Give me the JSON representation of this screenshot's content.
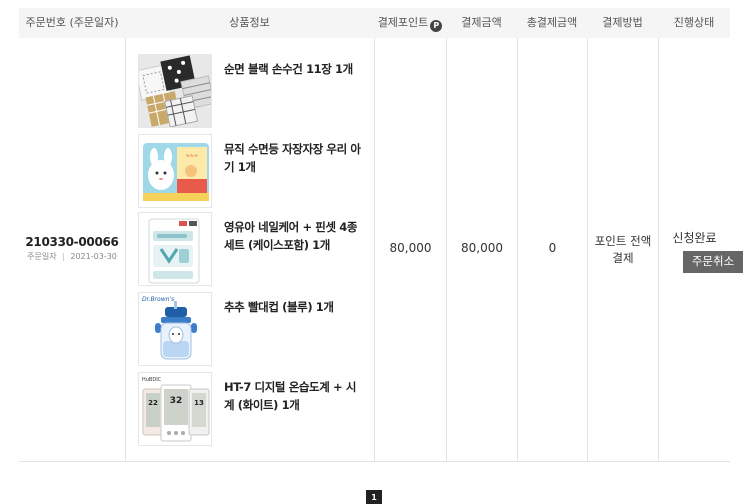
{
  "headers": {
    "order": "주문번호 (주문일자)",
    "product": "상품정보",
    "point": "결제포인트",
    "point_badge": "P",
    "amount": "결제금액",
    "total": "총결제금액",
    "method": "결제방법",
    "status": "진행상태"
  },
  "order": {
    "number": "210330-00066",
    "date_label": "주문일자",
    "date": "2021-03-30"
  },
  "items": [
    {
      "name": "순면 블랙 손수건 11장 1개"
    },
    {
      "name": "뮤직 수면등 자장자장 우리 아기 1개"
    },
    {
      "name": "영유아 네일케어 + 핀셋 4종 세트 (케이스포함) 1개"
    },
    {
      "name": "추추 빨대컵 (블루) 1개"
    },
    {
      "name": "HT-7 디지털 온습도계 + 시계 (화이트) 1개"
    }
  ],
  "payment": {
    "point": "80,000",
    "amount": "80,000",
    "total": "0",
    "method": "포인트 전액 결제"
  },
  "status": {
    "text": "신청완료",
    "cancel_label": "주문취소"
  },
  "pagination": {
    "current": "1"
  },
  "thumb_text": {
    "brand_dr": "Dr.Brown's",
    "brand_hubdic": "HuBDIC",
    "lcd_1": "22",
    "lcd_2": "32",
    "lcd_3": "13"
  }
}
